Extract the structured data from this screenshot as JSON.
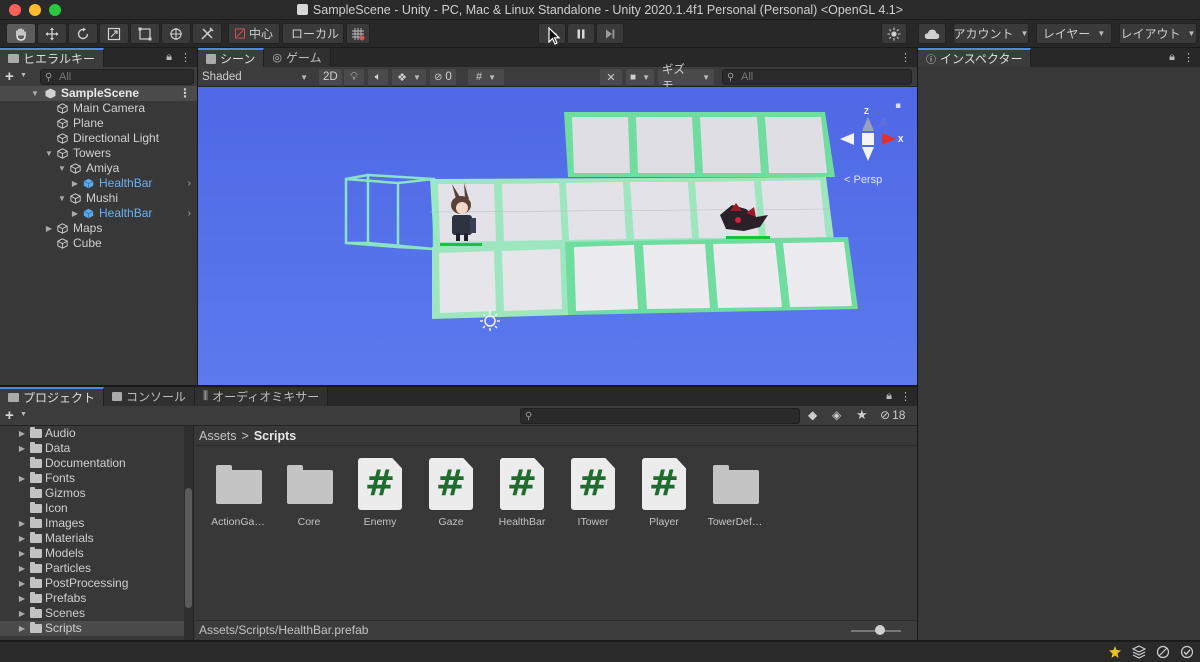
{
  "window": {
    "title": "SampleScene - Unity - PC, Mac & Linux Standalone - Unity 2020.1.4f1 Personal (Personal) <OpenGL 4.1>",
    "traffic_colors": [
      "#fe5f57",
      "#febc2e",
      "#28c840"
    ]
  },
  "toolbar": {
    "pivot_label": "中心",
    "space_label": "ローカル",
    "account_label": "アカウント",
    "layers_label": "レイヤー",
    "layout_label": "レイアウト"
  },
  "hierarchy": {
    "tab_label": "ヒエラルキー",
    "search_placeholder": "All",
    "scene_name": "SampleScene",
    "items": [
      {
        "label": "Main Camera"
      },
      {
        "label": "Plane"
      },
      {
        "label": "Directional Light"
      },
      {
        "label": "Towers"
      },
      {
        "label": "Amiya"
      },
      {
        "label": "HealthBar"
      },
      {
        "label": "Mushi"
      },
      {
        "label": "HealthBar"
      },
      {
        "label": "Maps"
      },
      {
        "label": "Cube"
      }
    ]
  },
  "scene": {
    "tabs": [
      {
        "label": "シーン"
      },
      {
        "label": "ゲーム"
      }
    ],
    "shading": "Shaded",
    "mode_2d": "2D",
    "hidden_count": "0",
    "gizmos_label": "ギズモ",
    "search_placeholder": "All",
    "gizmo_axes": {
      "y": "Y",
      "z": "Z",
      "x": "X"
    },
    "persp_label": "< Persp",
    "accent_color": "#4a8ae0"
  },
  "inspector": {
    "tab_label": "インスペクター"
  },
  "project": {
    "tabs": [
      {
        "label": "プロジェクト"
      },
      {
        "label": "コンソール"
      },
      {
        "label": "オーディオミキサー"
      }
    ],
    "visible_count": "18",
    "folders": [
      {
        "label": "Audio"
      },
      {
        "label": "Data"
      },
      {
        "label": "Documentation"
      },
      {
        "label": "Fonts"
      },
      {
        "label": "Gizmos"
      },
      {
        "label": "Icon"
      },
      {
        "label": "Images"
      },
      {
        "label": "Materials"
      },
      {
        "label": "Models"
      },
      {
        "label": "Particles"
      },
      {
        "label": "PostProcessing"
      },
      {
        "label": "Prefabs"
      },
      {
        "label": "Scenes"
      },
      {
        "label": "Scripts"
      }
    ],
    "breadcrumb": {
      "root": "Assets",
      "separator": ">",
      "current": "Scripts"
    },
    "assets": [
      {
        "name": "ActionGa…",
        "kind": "folder"
      },
      {
        "name": "Core",
        "kind": "folder"
      },
      {
        "name": "Enemy",
        "kind": "script"
      },
      {
        "name": "Gaze",
        "kind": "script"
      },
      {
        "name": "HealthBar",
        "kind": "script"
      },
      {
        "name": "ITower",
        "kind": "script"
      },
      {
        "name": "Player",
        "kind": "script"
      },
      {
        "name": "TowerDef…",
        "kind": "folder"
      }
    ],
    "script_glyph": "#",
    "status_path": "Assets/Scripts/HealthBar.prefab"
  }
}
